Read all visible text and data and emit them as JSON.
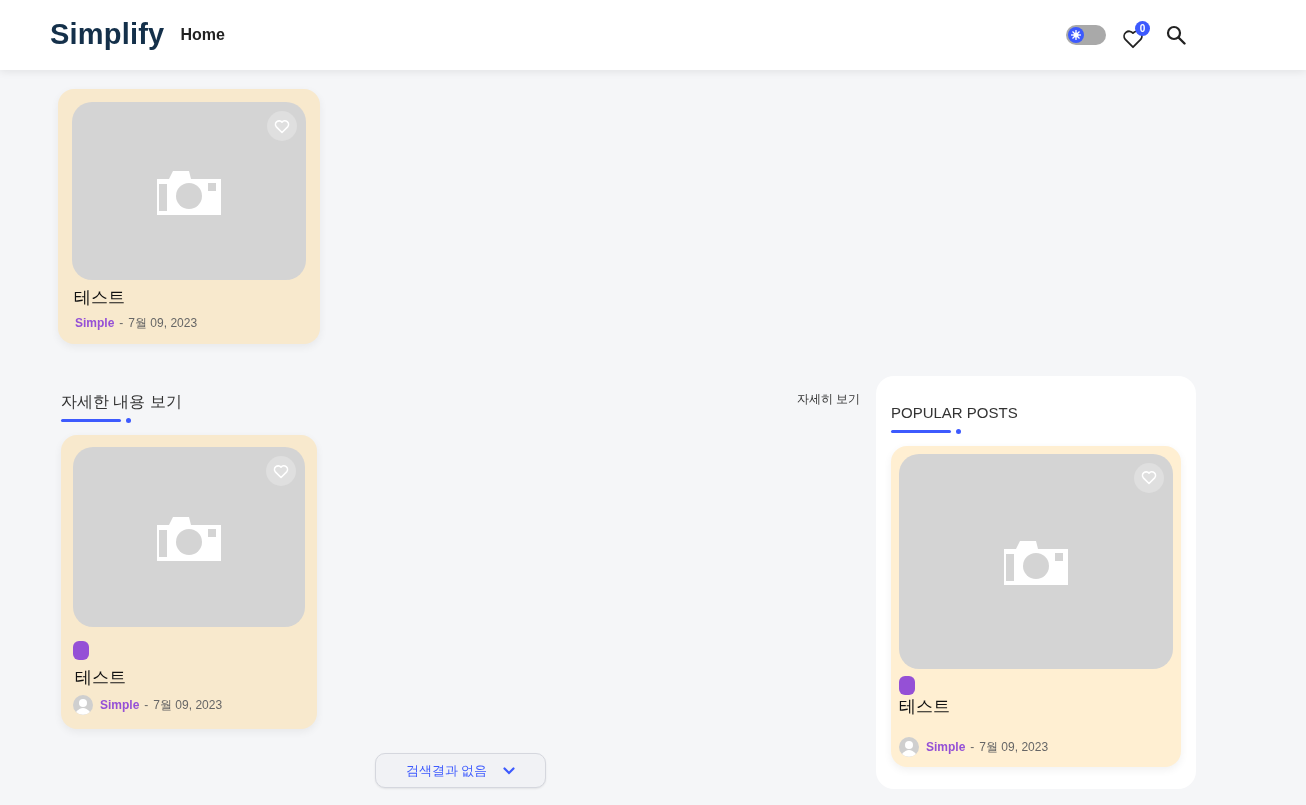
{
  "header": {
    "logo": "Simplify",
    "nav": [
      {
        "label": "Home"
      }
    ],
    "theme_toggle": {
      "dark": false
    },
    "favorites_count": "0"
  },
  "top_posts": [
    {
      "title": "테스트",
      "author": "Simple",
      "separator": "-",
      "date": "7월 09, 2023",
      "avatar": false,
      "liked": false
    }
  ],
  "section": {
    "title": "자세한 내용 보기",
    "more_link": "자세히 보기",
    "posts": [
      {
        "title": "테스트",
        "author": "Simple",
        "separator": "-",
        "date": "7월 09, 2023",
        "avatar": true,
        "liked": false,
        "tag": {
          "color": "#9550d6"
        }
      }
    ],
    "load_button": "검색결과 없음"
  },
  "sidebar": {
    "title": "POPULAR POSTS",
    "posts": [
      {
        "title": "테스트",
        "author": "Simple",
        "separator": "-",
        "date": "7월 09, 2023",
        "avatar": true,
        "liked": false,
        "tag": {
          "color": "#9550d6"
        }
      }
    ]
  }
}
